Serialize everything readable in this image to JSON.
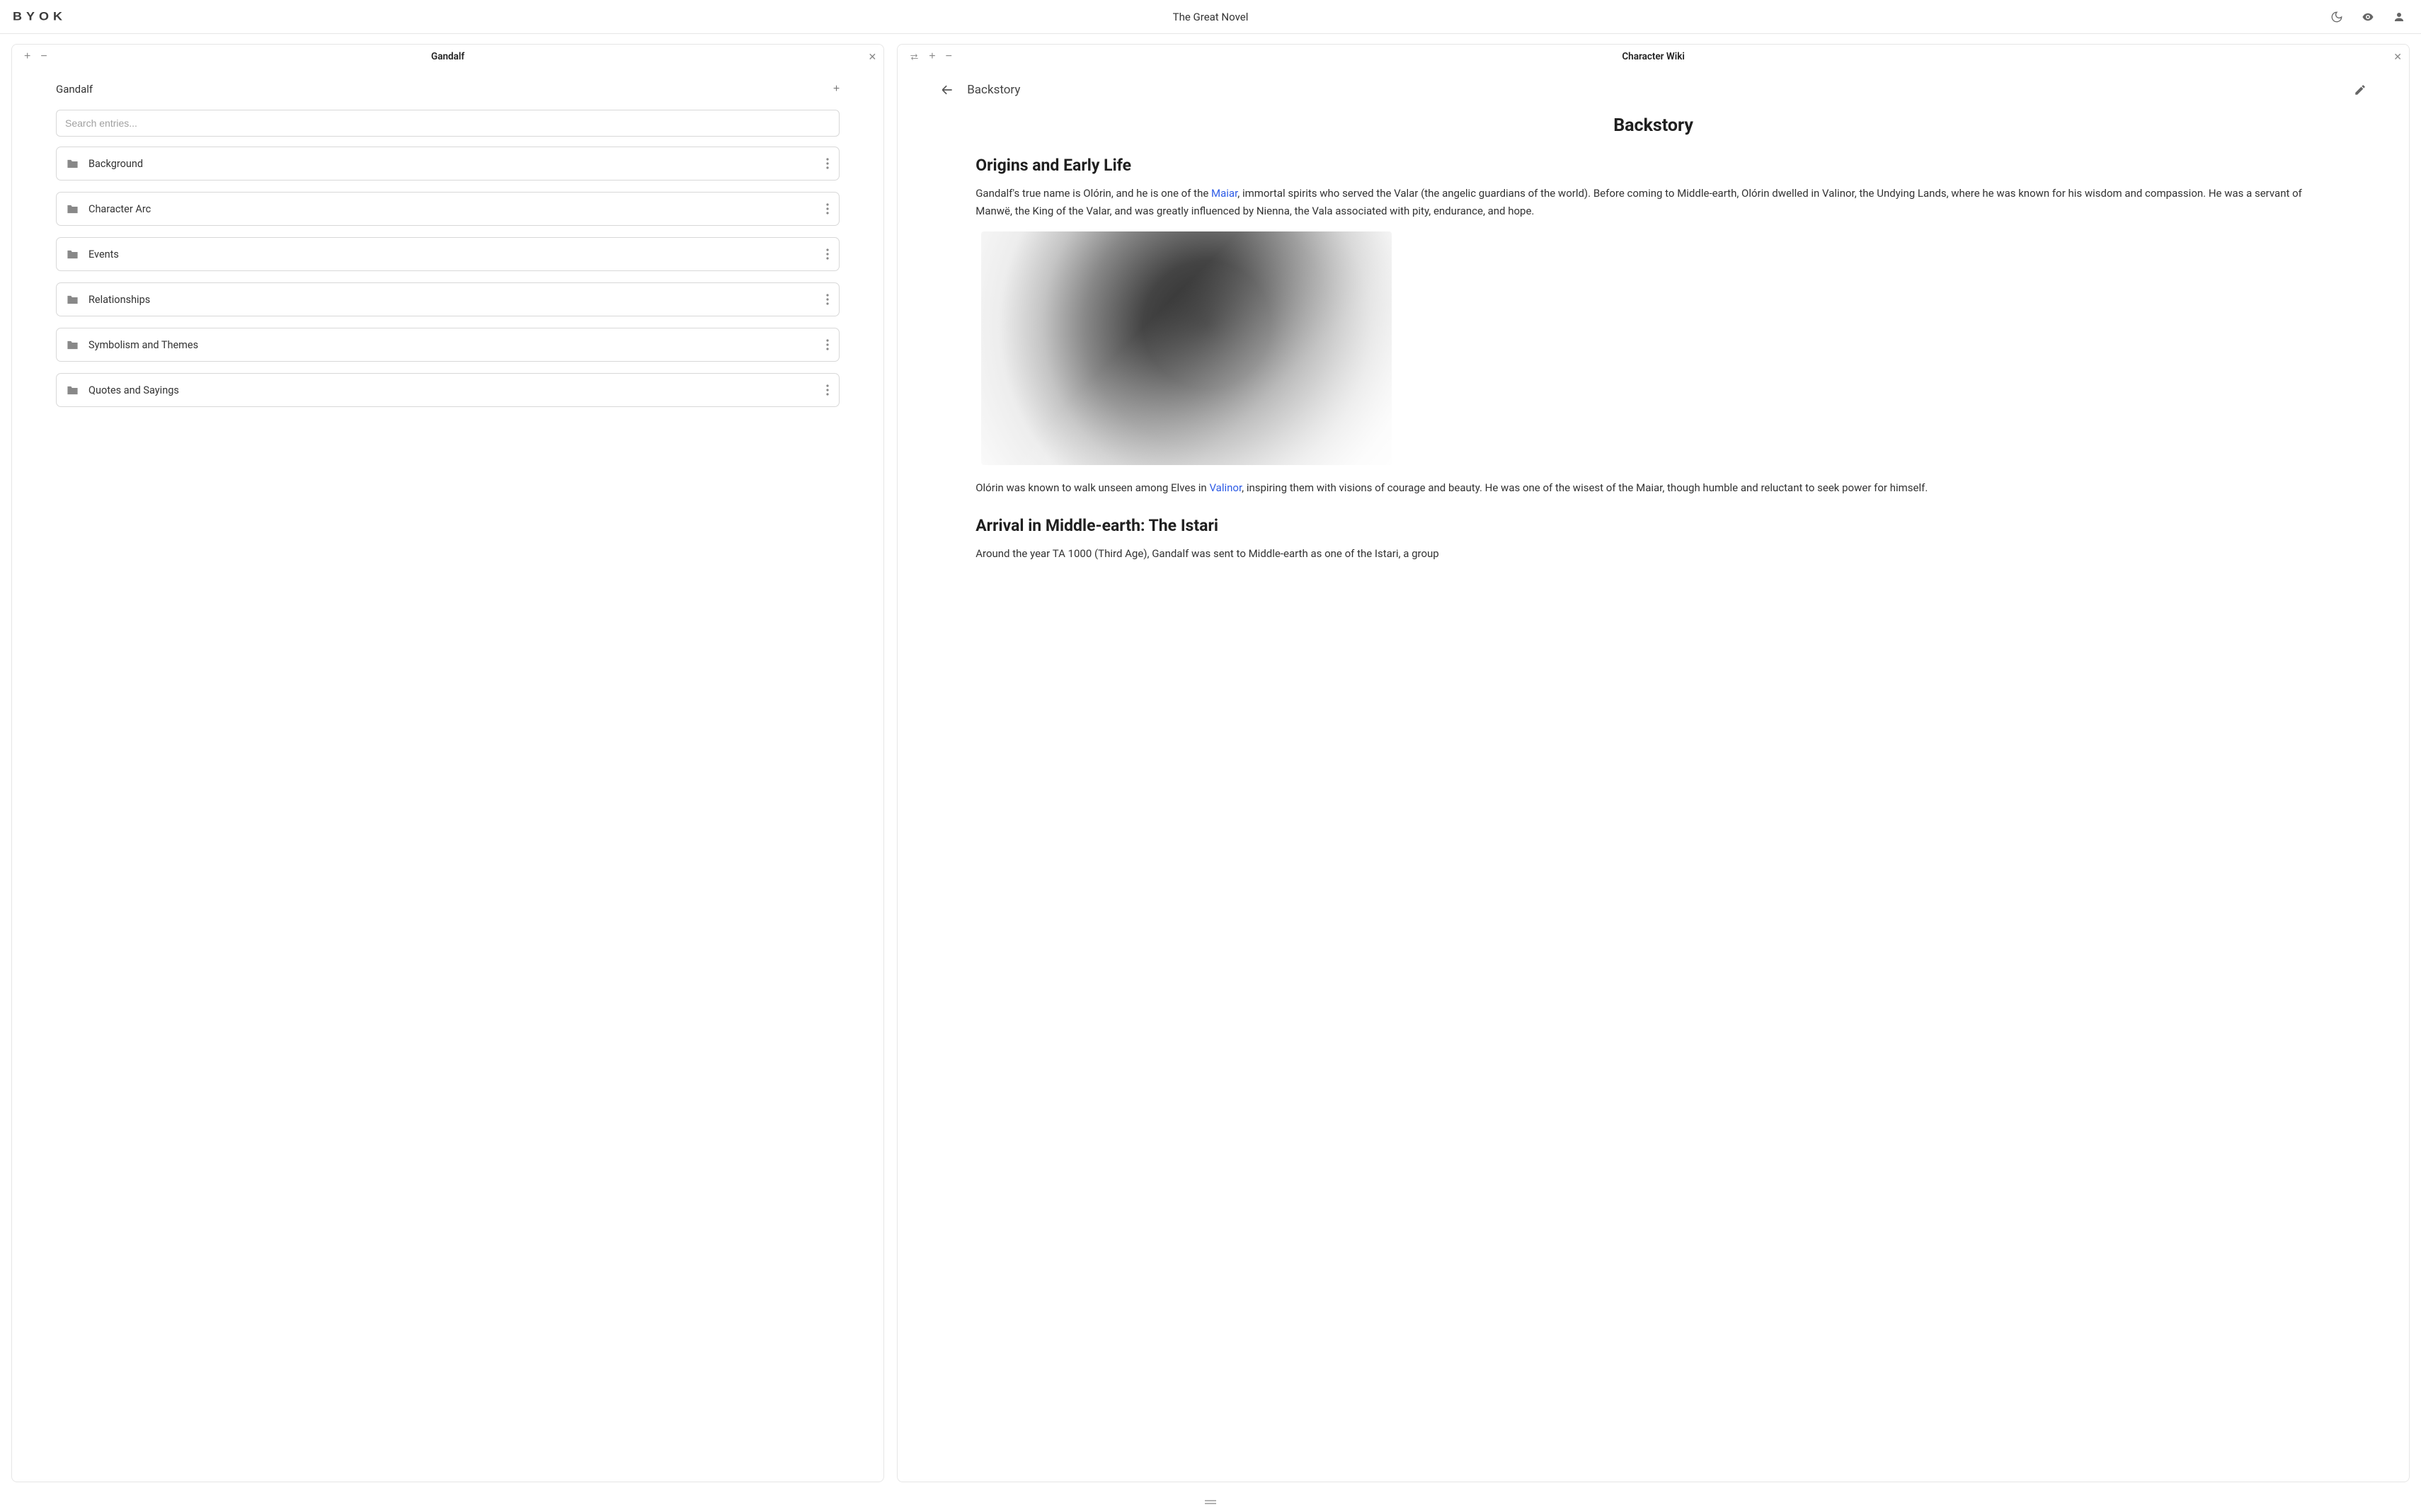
{
  "header": {
    "logo": "BYOK",
    "title": "The Great Novel"
  },
  "left": {
    "tab": "Gandalf",
    "breadcrumb": "Gandalf",
    "search_placeholder": "Search entries...",
    "entries": [
      {
        "label": "Background"
      },
      {
        "label": "Character Arc"
      },
      {
        "label": "Events"
      },
      {
        "label": "Relationships"
      },
      {
        "label": "Symbolism and Themes"
      },
      {
        "label": "Quotes and Sayings"
      }
    ]
  },
  "right": {
    "tab": "Character Wiki",
    "crumb": "Backstory",
    "title": "Backstory",
    "h1": "Origins and Early Life",
    "p1a": "Gandalf's true name is Olórin, and he is one of the ",
    "p1link": "Maiar",
    "p1b": ", immortal spirits who served the Valar (the angelic guardians of the world). Before coming to Middle-earth, Olórin dwelled in Valinor, the Undying Lands, where he was known for his wisdom and compassion. He was a servant of Manwë, the King of the Valar, and was greatly influenced by Nienna, the Vala associated with pity, endurance, and hope.",
    "p2a": "Olórin was known to walk unseen among Elves in ",
    "p2link": "Valinor",
    "p2b": ", inspiring them with visions of courage and beauty. He was one of the wisest of the Maiar, though humble and reluctant to seek power for himself.",
    "h2": "Arrival in Middle-earth: The Istari",
    "p3": "Around the year TA 1000 (Third Age), Gandalf was sent to Middle-earth as one of the Istari, a group"
  }
}
